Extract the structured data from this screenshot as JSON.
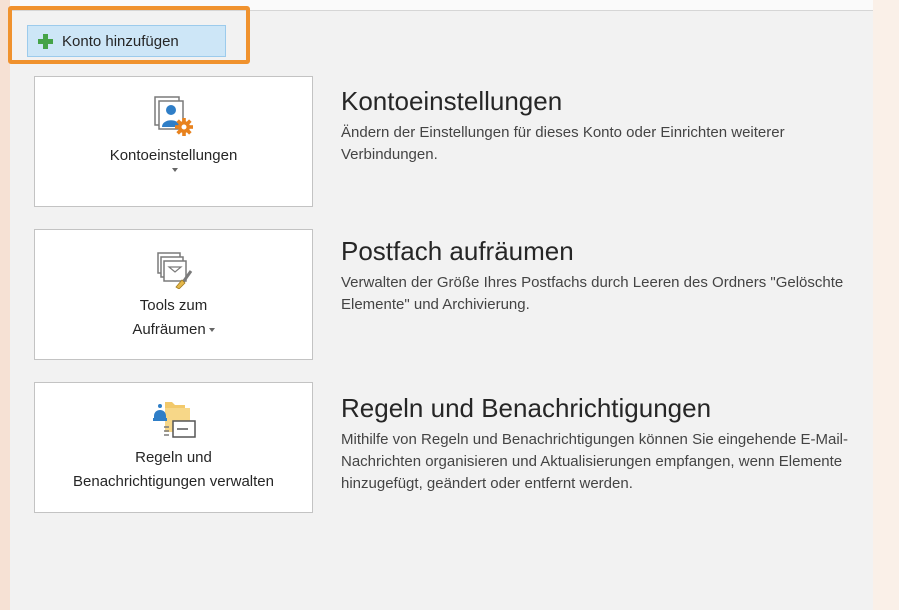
{
  "toolbar": {
    "add_account_label": "Konto hinzufügen"
  },
  "sections": [
    {
      "button_label": "Kontoeinstellungen",
      "title": "Kontoeinstellungen",
      "description": "Ändern der Einstellungen für dieses Konto oder Einrichten weiterer Verbindungen.",
      "icon": "account-settings-icon"
    },
    {
      "button_label_line1": "Tools zum",
      "button_label_line2": "Aufräumen",
      "title": "Postfach aufräumen",
      "description": "Verwalten der Größe Ihres Postfachs durch Leeren des Ordners \"Gelöschte Elemente\" und Archivierung.",
      "icon": "cleanup-tools-icon"
    },
    {
      "button_label_line1": "Regeln und",
      "button_label_line2": "Benachrichtigungen verwalten",
      "title": "Regeln und Benachrichtigungen",
      "description": "Mithilfe von Regeln und Benachrichtigungen können Sie eingehende E-Mail-Nachrichten organisieren und Aktualisierungen empfangen, wenn Elemente hinzugefügt, geändert oder entfernt werden.",
      "icon": "rules-alerts-icon"
    }
  ],
  "colors": {
    "highlight": "#f0922e",
    "add_button_bg": "#cde6f7",
    "plus": "#45a348"
  }
}
